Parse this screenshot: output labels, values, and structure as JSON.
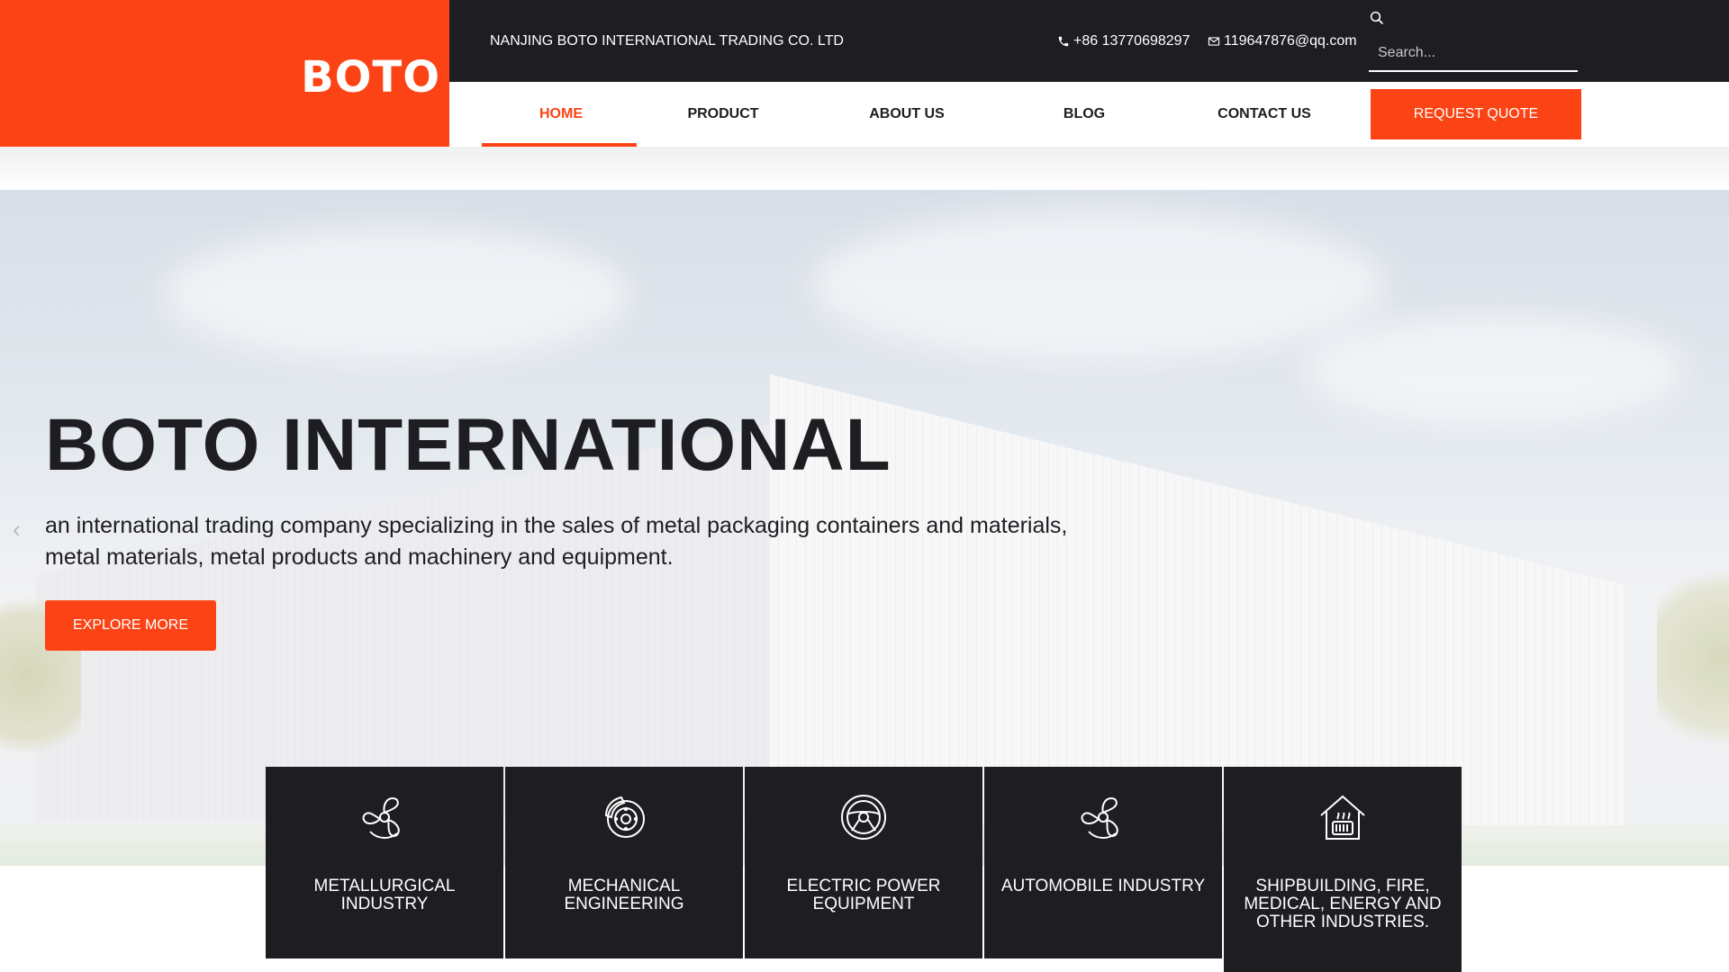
{
  "brand": {
    "logo_text": "BOTO",
    "accent": "#fb4315",
    "dark": "#1d1d22"
  },
  "topbar": {
    "company": "NANJING BOTO INTERNATIONAL TRADING CO. LTD",
    "phone": "+86 13770698297",
    "email": "119647876@qq.com",
    "search_placeholder": "Search..."
  },
  "nav": {
    "items": [
      {
        "label": "HOME",
        "active": true
      },
      {
        "label": "PRODUCT"
      },
      {
        "label": "ABOUT US"
      },
      {
        "label": "BLOG"
      },
      {
        "label": "CONTACT US"
      }
    ],
    "quote_button": "REQUEST QUOTE"
  },
  "hero": {
    "title": "BOTO INTERNATIONAL",
    "subtitle": "an international trading company specializing in the sales of metal packaging containers and materials, metal materials, metal products and machinery and equipment.",
    "button": "EXPLORE MORE",
    "prev_arrow": "‹"
  },
  "industries": [
    {
      "label": "METALLURGICAL INDUSTRY",
      "icon": "fan-icon"
    },
    {
      "label": "MECHANICAL ENGINEERING",
      "icon": "brake-disc-icon"
    },
    {
      "label": "ELECTRIC POWER EQUIPMENT",
      "icon": "steering-wheel-icon"
    },
    {
      "label": "AUTOMOBILE INDUSTRY",
      "icon": "fan-icon"
    },
    {
      "label": "SHIPBUILDING, FIRE, MEDICAL, ENERGY AND OTHER INDUSTRIES.",
      "icon": "house-heater-icon"
    }
  ]
}
